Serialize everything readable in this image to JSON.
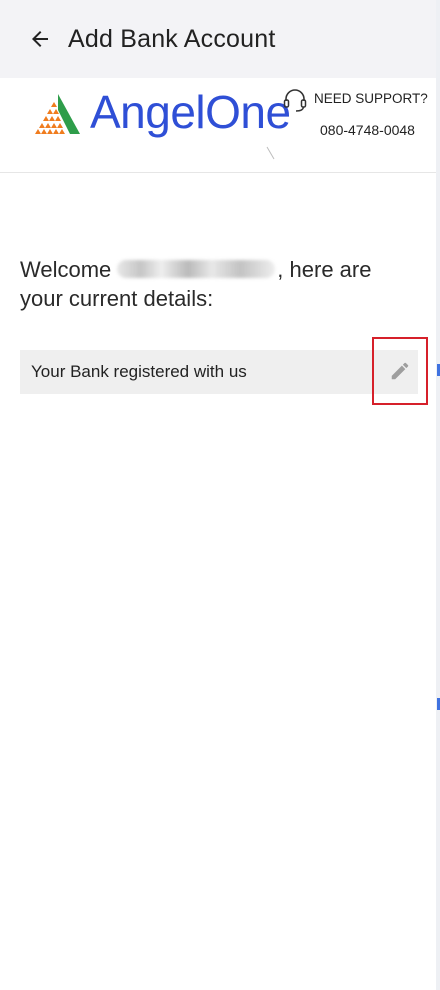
{
  "appbar": {
    "title": "Add Bank Account",
    "back_icon": "arrow-left-icon"
  },
  "brand": {
    "logo_text": "AngelOne",
    "support_label": "NEED SUPPORT?",
    "support_phone": "080-4748-0048",
    "support_icon": "headset-icon",
    "colors": {
      "logo_blue": "#2f4fd6",
      "logo_orange": "#f07c1e"
    }
  },
  "main": {
    "welcome_prefix": "Welcome",
    "welcome_suffix": ", here are your current details:",
    "bank_label": "Your Bank registered with us",
    "edit_icon": "pencil-icon",
    "highlight_color": "#d6202a"
  }
}
